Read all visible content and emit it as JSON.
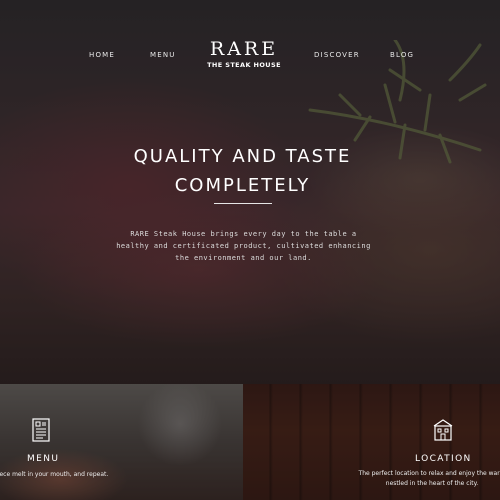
{
  "nav": {
    "items": [
      "HOME",
      "MENU",
      "DISCOVER",
      "BLOG"
    ]
  },
  "logo": {
    "title": "RARE",
    "subtitle": "THE STEAK HOUSE"
  },
  "hero": {
    "headline_line1": "QUALITY AND TASTE",
    "headline_line2": "COMPLETELY",
    "intro": "RARE Steak House brings every day to the table a healthy and certificated product, cultivated enhancing the environment and our land."
  },
  "panels": {
    "menu": {
      "icon": "menu-document-icon",
      "title": "MENU",
      "text": "piece melt in your mouth, and repeat."
    },
    "location": {
      "icon": "building-icon",
      "title": "LOCATION",
      "text_line1": "The perfect location to relax and enjoy the warm",
      "text_line2": "nestled in the heart of the city."
    }
  },
  "colors": {
    "overlay": "#2b2a2c",
    "text": "#ffffff",
    "accent_meat": "#6e2d34"
  }
}
